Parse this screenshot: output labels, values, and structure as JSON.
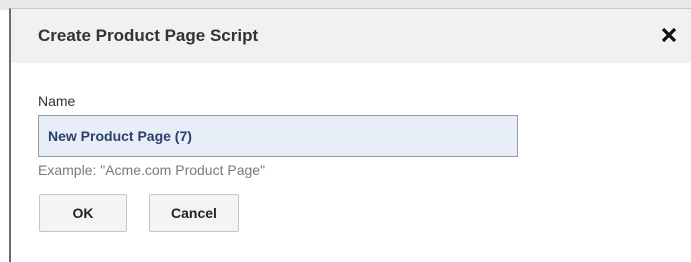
{
  "dialog": {
    "title": "Create Product Page Script",
    "close_icon": "close-icon",
    "name_label": "Name",
    "name_value": "New Product Page (7)",
    "hint": "Example: \"Acme.com Product Page\"",
    "ok_label": "OK",
    "cancel_label": "Cancel"
  },
  "colors": {
    "header_bg": "#f1f1f1",
    "input_bg": "#e8eef7",
    "input_text": "#2b3f6b",
    "button_bg": "#f4f4f4"
  }
}
